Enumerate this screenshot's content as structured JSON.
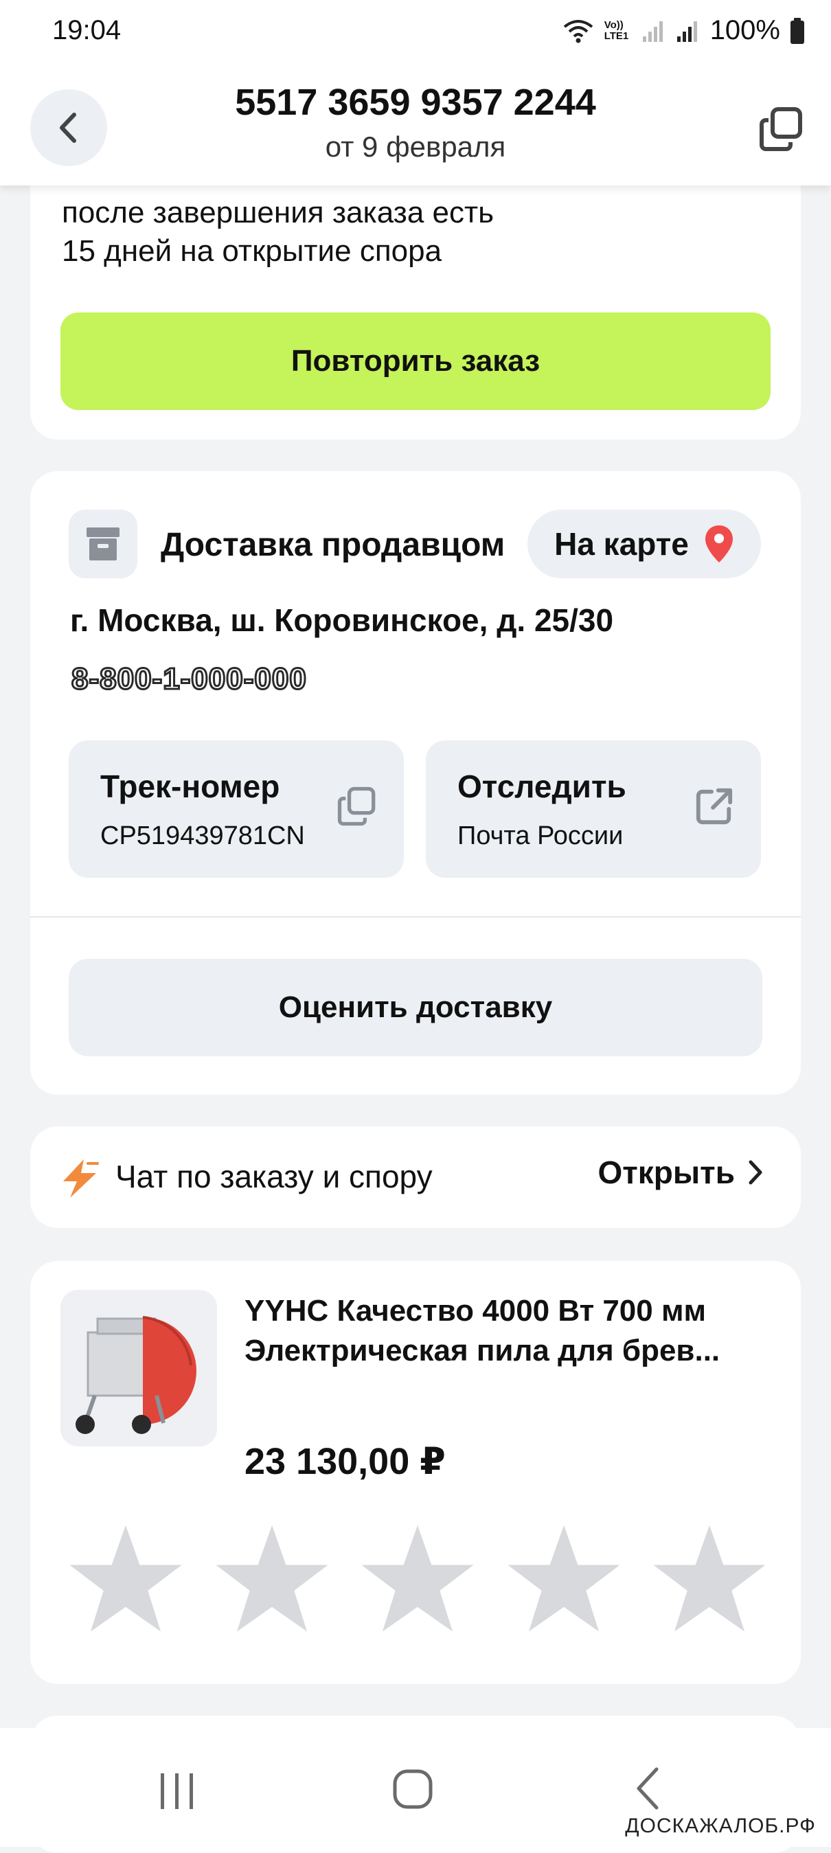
{
  "status_bar": {
    "time": "19:04",
    "battery": "100%",
    "network": "Vo)) LTE1"
  },
  "header": {
    "order_number": "5517 3659 9357 2244",
    "order_date": "от 9 февраля",
    "back_icon": "chevron-left-icon",
    "copy_icon": "copy-icon"
  },
  "order_actions": {
    "dispute_note_line1": "после завершения заказа есть",
    "dispute_note_line2": "15 дней на открытие спора",
    "repeat_button": "Повторить заказ",
    "repeat_button_color": "#c4f35a"
  },
  "delivery": {
    "title": "Доставка продавцом",
    "map_button": "На карте",
    "address": "г. Москва, ш. Коровинское, д. 25/30",
    "phone": "8-800-1-000-000",
    "track_title": "Трек-номер",
    "track_number": "CP519439781CN",
    "follow_title": "Отследить",
    "follow_service": "Почта России",
    "rate_button": "Оценить доставку",
    "pin_color": "#f04b4b"
  },
  "chat": {
    "label": "Чат по заказу и спору",
    "open_label": "Открыть",
    "icon_color": "#f28a3c"
  },
  "product": {
    "title": "YYHC Качество 4000 Вт 700 мм Электрическая пила для брев...",
    "price": "23 130,00 ₽",
    "rating": 0,
    "max_rating": 5
  },
  "watermark": "ДОСКАЖАЛОБ.РФ"
}
